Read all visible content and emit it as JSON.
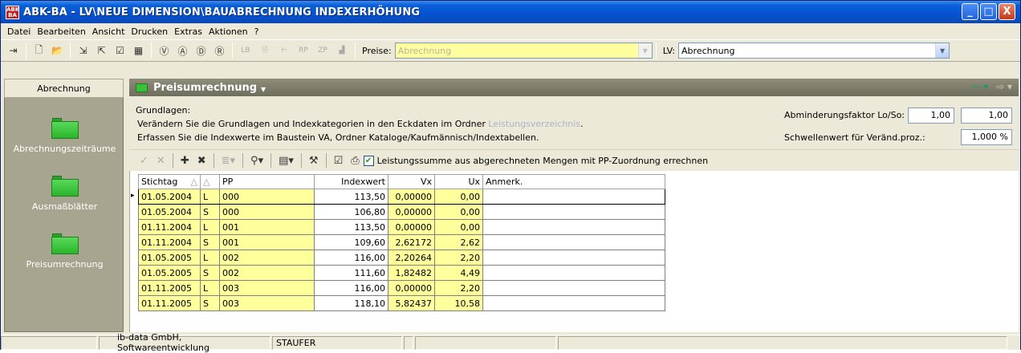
{
  "window": {
    "title": "ABK-BA - LV\\NEUE DIMENSION\\BAUABRECHNUNG INDEXERHÖHUNG",
    "logo_text": "ABK BA",
    "buttons": {
      "minimize": "_",
      "maximize": "□",
      "close": "X"
    }
  },
  "menu": [
    {
      "label": "Datei"
    },
    {
      "label": "Bearbeiten"
    },
    {
      "label": "Ansicht"
    },
    {
      "label": "Drucken"
    },
    {
      "label": "Extras"
    },
    {
      "label": "Aktionen"
    },
    {
      "label": "?"
    }
  ],
  "toolbar": {
    "disabled_labels": [
      "LB",
      "RP",
      "ZP"
    ],
    "preise_label": "Preise:",
    "preise_value": "Abrechnung",
    "lv_label": "LV:",
    "lv_value": "Abrechnung"
  },
  "sidebar": {
    "header": "Abrechnung",
    "items": [
      {
        "label": "Abrechnungszeiträume"
      },
      {
        "label": "Ausmaßblätter"
      },
      {
        "label": "Preisumrechnung"
      }
    ]
  },
  "main": {
    "title": "Preisumrechnung",
    "info": {
      "heading": "Grundlagen:",
      "line1_prefix": "Verändern Sie die Grundlagen und Indexkategorien in den Eckdaten im Ordner ",
      "line1_link": "Leistungsverzeichnis",
      "line1_suffix": ".",
      "line2": "Erfassen Sie die Indexwerte im Baustein VA, Ordner Kataloge/Kaufmännisch/Indextabellen."
    },
    "fields": {
      "abminderung_label": "Abminderungsfaktor Lo/So:",
      "abminderung_lo": "1,00",
      "abminderung_so": "1,00",
      "schwellenwert_label": "Schwellenwert für Veränd.proz.:",
      "schwellenwert_value": "1,000 %"
    },
    "grid_toolbar": {
      "checkbox_label": "Leistungssumme aus abgerechneten Mengen mit PP-Zuordnung errechnen",
      "checkbox_checked": true
    }
  },
  "grid": {
    "columns": [
      "Stichtag",
      "",
      "PP",
      "Indexwert",
      "Vx",
      "Ux",
      "Anmerk."
    ],
    "rows": [
      [
        "01.05.2004",
        "L",
        "000",
        "113,50",
        "0,00000",
        "0,00",
        ""
      ],
      [
        "01.05.2004",
        "S",
        "000",
        "106,80",
        "0,00000",
        "0,00",
        ""
      ],
      [
        "01.11.2004",
        "L",
        "001",
        "113,50",
        "0,00000",
        "0,00",
        ""
      ],
      [
        "01.11.2004",
        "S",
        "001",
        "109,60",
        "2,62172",
        "2,62",
        ""
      ],
      [
        "01.05.2005",
        "L",
        "002",
        "116,00",
        "2,20264",
        "2,20",
        ""
      ],
      [
        "01.05.2005",
        "S",
        "002",
        "111,60",
        "1,82482",
        "4,49",
        ""
      ],
      [
        "01.11.2005",
        "L",
        "003",
        "116,00",
        "0,00000",
        "2,20",
        ""
      ],
      [
        "01.11.2005",
        "S",
        "003",
        "118,10",
        "5,82437",
        "10,58",
        ""
      ]
    ]
  },
  "statusbar": {
    "company": "ib-data GmbH, Softwareentwicklung",
    "user": "STAUFER"
  },
  "colors": {
    "titlebar": "#0553d0",
    "editable_cell": "#ffff9c",
    "sidebar": "#a7a58f",
    "panel_header": "#7a7866"
  }
}
